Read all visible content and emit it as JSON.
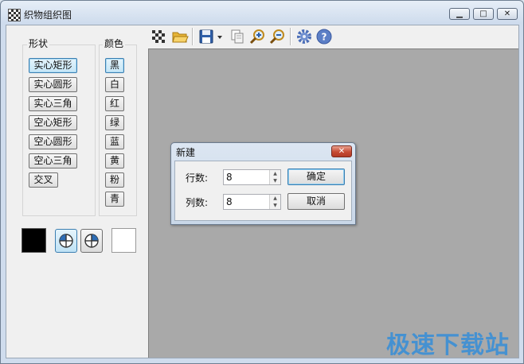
{
  "window": {
    "title": "织物组织图",
    "minimize_glyph": "▁",
    "maximize_glyph": "□",
    "close_glyph": "✕"
  },
  "shape_group": {
    "label": "形状",
    "items": [
      "实心矩形",
      "实心圆形",
      "实心三角",
      "空心矩形",
      "空心圆形",
      "空心三角",
      "交叉"
    ],
    "selected": "实心矩形"
  },
  "color_group": {
    "label": "颜色",
    "items": [
      "黑",
      "白",
      "红",
      "绿",
      "蓝",
      "黄",
      "粉",
      "青"
    ],
    "selected": "黑"
  },
  "swatches": {
    "foreground": "#000000",
    "background": "#ffffff"
  },
  "toolbar": {
    "icons": [
      "pattern-icon",
      "open-folder-icon",
      "save-icon",
      "dropdown-arrow-icon",
      "copy-icon",
      "zoom-in-icon",
      "zoom-out-icon",
      "settings-gear-icon",
      "help-icon"
    ]
  },
  "dialog": {
    "title": "新建",
    "close_glyph": "✕",
    "rows_label": "行数:",
    "rows_value": "8",
    "cols_label": "列数:",
    "cols_value": "8",
    "ok_label": "确定",
    "cancel_label": "取消"
  },
  "canvas": {
    "background": "#a9a9a9"
  },
  "watermark": "极速下载站"
}
